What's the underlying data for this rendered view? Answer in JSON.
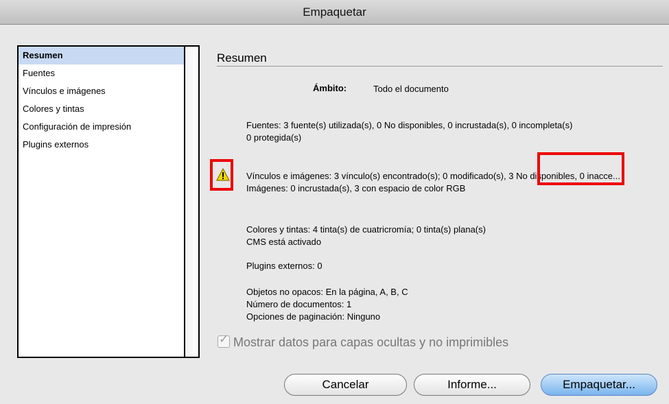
{
  "window": {
    "title": "Empaquetar"
  },
  "sidebar": {
    "items": [
      {
        "label": "Resumen",
        "selected": true
      },
      {
        "label": "Fuentes",
        "selected": false
      },
      {
        "label": "Vínculos e imágenes",
        "selected": false
      },
      {
        "label": "Colores y tintas",
        "selected": false
      },
      {
        "label": "Configuración de impresión",
        "selected": false
      },
      {
        "label": "Plugins externos",
        "selected": false
      }
    ]
  },
  "summary": {
    "title": "Resumen",
    "scope_label": "Ámbito:",
    "scope_value": "Todo el documento",
    "fonts_line1": "Fuentes: 3 fuente(s) utilizada(s), 0 No disponibles, 0 incrustada(s), 0 incompleta(s)",
    "fonts_line2": "0 protegida(s)",
    "links_part1": "Vínculos e imágenes: 3 vínculo(s) encontrado(s); 0 modificado(s),",
    "links_part2": "3 No disponibles,",
    "links_part3": "0 inacce...",
    "links_line2": "Imágenes: 0 incrustada(s), 3 con espacio de color RGB",
    "colors_line1": "Colores y tintas: 4 tinta(s) de cuatricromía; 0 tinta(s) plana(s)",
    "colors_line2": "CMS está activado",
    "plugins_line": "Plugins externos: 0",
    "misc_line1": "Objetos no opacos: En la página, A, B, C",
    "misc_line2": "Número de documentos: 1",
    "misc_line3": "Opciones de paginación: Ninguno"
  },
  "options": {
    "hidden_layers_label": "Mostrar datos para capas ocultas y no imprimibles",
    "hidden_layers_checked": true
  },
  "buttons": {
    "cancel": "Cancelar",
    "report": "Informe...",
    "package": "Empaquetar..."
  },
  "icons": {
    "warning": "warning-triangle-icon",
    "checkmark": "checkmark-icon"
  },
  "colors": {
    "highlight": "#ee0000",
    "selection": "#c8d9f3",
    "primary_button": "#79b4ee",
    "warning": "#f5d800"
  }
}
